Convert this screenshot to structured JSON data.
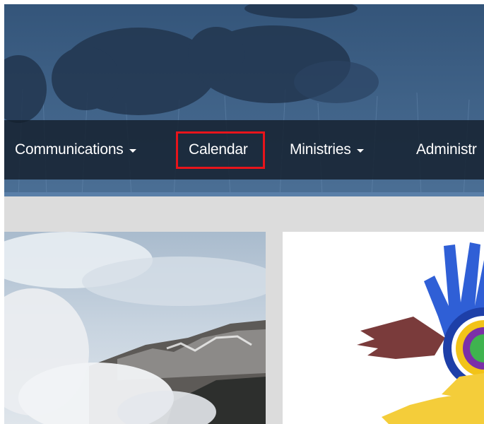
{
  "nav": {
    "items": [
      {
        "label": "Communications",
        "has_dropdown": true
      },
      {
        "label": "Calendar",
        "has_dropdown": false,
        "highlighted": true
      },
      {
        "label": "Ministries",
        "has_dropdown": true
      },
      {
        "label": "Administr",
        "has_dropdown": false
      }
    ],
    "highlight_color": "#e8141b"
  },
  "banner": {
    "image": "bison-grazing-photo",
    "tint_color": "#46698f"
  },
  "cards": [
    {
      "image": "mountain-wildfire-smoke-photo"
    },
    {
      "image": "colorful-hands-logo"
    }
  ],
  "colors": {
    "navbar_bg": "#141e2c",
    "content_bg": "#dcdcdc"
  }
}
